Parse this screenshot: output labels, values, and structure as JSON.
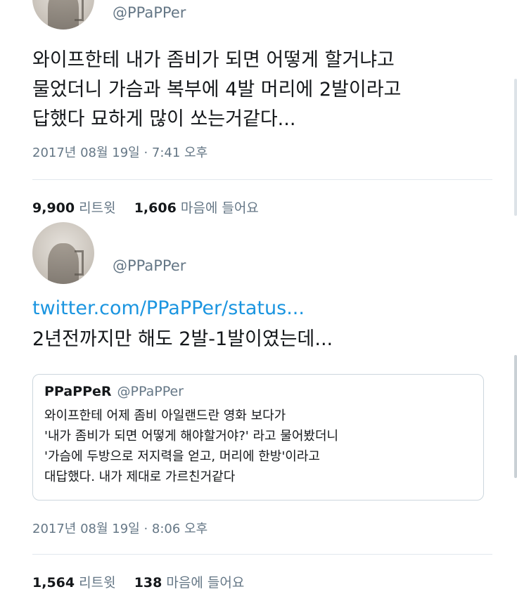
{
  "tweets": [
    {
      "handle": "@PPaPPer",
      "lines": [
        "와이프한테 내가 좀비가 되면 어떻게 할거냐고",
        "물었더니 가슴과 복부에 4발 머리에 2발이라고",
        "답했다 묘하게 많이 쏘는거같다..."
      ],
      "timestamp": "2017년 08월 19일 · 7:41 오후",
      "retweet_count": "9,900",
      "retweet_label": "리트윗",
      "like_count": "1,606",
      "like_label": "마음에 들어요"
    },
    {
      "handle": "@PPaPPer",
      "link": "twitter.com/PPaPPer/status...",
      "lines": [
        "2년전까지만 해도 2발-1발이였는데..."
      ],
      "quote": {
        "name": "PPaPPeR",
        "handle": "@PPaPPer",
        "lines": [
          "와이프한테 어제 좀비 아일랜드란 영화 보다가",
          "'내가 좀비가 되면 어떻게 해야할거야?' 라고 물어봤더니",
          "'가슴에 두방으로 저지력을 얻고, 머리에 한방'이라고",
          "대답했다. 내가 제대로 가르친거같다"
        ]
      },
      "timestamp": "2017년 08월 19일 · 8:06 오후",
      "retweet_count": "1,564",
      "retweet_label": "리트윗",
      "like_count": "138",
      "like_label": "마음에 들어요"
    }
  ],
  "colors": {
    "text": "#14171a",
    "muted": "#657786",
    "link": "#1b95e0",
    "border": "#ccd6dd",
    "divider": "#e1e8ed"
  }
}
